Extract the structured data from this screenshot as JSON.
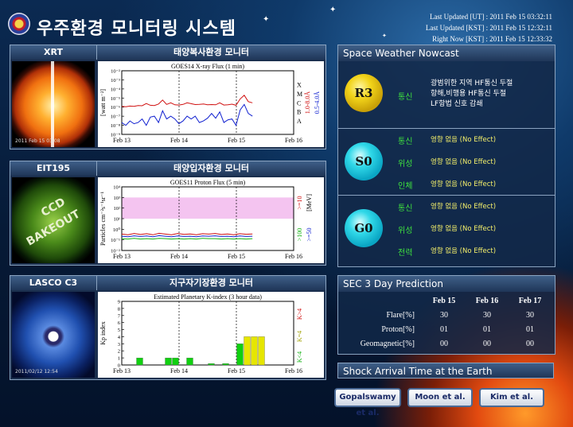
{
  "header": {
    "title": "우주환경 모니터링 시스템",
    "timestamps": [
      "Last Updated [UT] : 2011 Feb 15 03:32:11",
      "Last Updated [KST] : 2011 Feb 15 12:32:11",
      "Right Now [KST] : 2011 Feb 15 12:33:32"
    ]
  },
  "panels": [
    {
      "image_label": "XRT",
      "chart_label": "태양복사환경 모니터",
      "thumb_caption": "2011 Feb 15 03:08"
    },
    {
      "image_label": "EIT195",
      "chart_label": "태양입자환경 모니터",
      "thumb_text": [
        "CCD",
        "BAKEOUT"
      ]
    },
    {
      "image_label": "LASCO C3",
      "chart_label": "지구자기장환경 모니터",
      "thumb_caption": "2011/02/12 12:54"
    }
  ],
  "xray_chart": {
    "title": "GOES14 X-ray Flux (1 min)",
    "ylabel": "[watt m⁻²]",
    "y_ticks": [
      "10⁻²",
      "10⁻³",
      "10⁻⁴",
      "10⁻⁵",
      "10⁻⁶",
      "10⁻⁷",
      "10⁻⁸",
      "10⁻⁹"
    ],
    "x_ticks": [
      "Feb 13",
      "Feb 14",
      "Feb 15",
      "Feb 16"
    ],
    "classes": [
      "X",
      "M",
      "C",
      "B",
      "A"
    ],
    "right_label_red": "1.0-8.0Å",
    "right_label_blue": "0.5-4.0Å"
  },
  "proton_chart": {
    "title": "GOES11 Proton Flux (5 min)",
    "ylabel": "Particles cm⁻²s⁻¹sr⁻¹",
    "y_ticks": [
      "10⁴",
      "10³",
      "10²",
      "10¹",
      "10⁰",
      "10⁻¹",
      "10⁻²"
    ],
    "x_ticks": [
      "Feb 13",
      "Feb 14",
      "Feb 15",
      "Feb 16"
    ],
    "right_label_red": ">=10",
    "right_label_green": ">100",
    "right_label_blue": ">=50",
    "right_label_unit": "[MeV]"
  },
  "kp_chart": {
    "title": "Estimated Planetary K-index (3 hour data)",
    "ylabel": "Kp index",
    "y_ticks": [
      "9",
      "8",
      "7",
      "6",
      "5",
      "4",
      "3",
      "2",
      "1",
      "0"
    ],
    "x_ticks": [
      "Feb 13",
      "Feb 14",
      "Feb 15",
      "Feb 16"
    ],
    "legend_red": "K>4",
    "legend_yellow": "K=4",
    "legend_green": "K<4"
  },
  "chart_data": [
    {
      "type": "line",
      "title": "GOES14 X-ray Flux (1 min)",
      "ylabel": "[watt m⁻²]",
      "x_ticks": [
        "Feb 13",
        "Feb 14",
        "Feb 15",
        "Feb 16"
      ],
      "ylim": [
        1e-09,
        0.01
      ],
      "log_y": true,
      "series": [
        {
          "name": "1.0-8.0Å",
          "color": "#d01010",
          "values": [
            1.2e-06,
            1.1e-06,
            1.3e-06,
            1.2e-06,
            1.5e-06,
            1.4e-06,
            2.5e-06,
            1.6e-06,
            1.5e-06,
            2.2e-06,
            6e-06,
            2e-06,
            3e-06,
            1.8e-06,
            1.7e-06,
            2e-06,
            3e-06,
            2.4e-06,
            1.9e-06,
            2e-06,
            2.2e-06,
            1.8e-06,
            1.9e-06,
            1.8e-06,
            3e-06,
            1.7e-06,
            1.8e-06,
            2.1e-06,
            1.6e-06,
            8e-06,
            2e-05,
            4e-06,
            3e-06
          ]
        },
        {
          "name": "0.5-4.0Å",
          "color": "#1020d0",
          "values": [
            2e-08,
            1e-08,
            3e-08,
            1.5e-08,
            2e-08,
            5e-08,
            1e-08,
            8e-08,
            1e-07,
            2e-08,
            4e-07,
            5e-08,
            1e-07,
            5e-08,
            1.5e-08,
            3e-08,
            1e-07,
            5e-08,
            1e-07,
            2e-08,
            3e-08,
            6e-08,
            2e-07,
            6e-08,
            3e-07,
            2e-08,
            4e-08,
            5e-08,
            1e-08,
            5e-07,
            2e-06,
            2e-07,
            1e-07
          ]
        }
      ]
    },
    {
      "type": "line",
      "title": "GOES11 Proton Flux (5 min)",
      "ylabel": "Particles cm⁻²s⁻¹sr⁻¹",
      "x_ticks": [
        "Feb 13",
        "Feb 14",
        "Feb 15",
        "Feb 16"
      ],
      "ylim": [
        0.01,
        10000.0
      ],
      "log_y": true,
      "series": [
        {
          "name": ">=10",
          "color": "#d01010",
          "values": [
            0.35,
            0.3,
            0.4,
            0.32,
            0.38,
            0.3,
            0.42,
            0.35,
            0.3,
            0.4,
            0.33,
            0.36,
            0.3,
            0.38,
            0.35,
            0.4,
            0.32,
            0.36,
            0.3,
            0.38,
            0.34,
            0.36
          ]
        },
        {
          "name": ">=50",
          "color": "#1020d0",
          "values": [
            0.22,
            0.2,
            0.24,
            0.21,
            0.23,
            0.2,
            0.25,
            0.22,
            0.2,
            0.23,
            0.21,
            0.22,
            0.2,
            0.23,
            0.22,
            0.24,
            0.21,
            0.22,
            0.2,
            0.23,
            0.21,
            0.22
          ]
        },
        {
          "name": ">100",
          "color": "#10b010",
          "values": [
            0.13,
            0.12,
            0.14,
            0.12,
            0.13,
            0.12,
            0.14,
            0.13,
            0.12,
            0.13,
            0.12,
            0.13,
            0.12,
            0.14,
            0.13,
            0.13,
            0.12,
            0.13,
            0.12,
            0.13,
            0.12,
            0.13
          ]
        }
      ]
    },
    {
      "type": "bar",
      "title": "Estimated Planetary K-index (3 hour data)",
      "ylabel": "Kp index",
      "x_ticks": [
        "Feb 13",
        "Feb 14",
        "Feb 15",
        "Feb 16"
      ],
      "ylim": [
        0,
        9
      ],
      "bars": [
        {
          "index": 2,
          "value": 1,
          "color": "#10d010"
        },
        {
          "index": 6,
          "value": 1,
          "color": "#10d010"
        },
        {
          "index": 7,
          "value": 1,
          "color": "#10d010"
        },
        {
          "index": 9,
          "value": 1,
          "color": "#10d010"
        },
        {
          "index": 12,
          "value": 0.2,
          "color": "#10d010"
        },
        {
          "index": 14,
          "value": 0.2,
          "color": "#10d010"
        },
        {
          "index": 16,
          "value": 3,
          "color": "#10d010"
        },
        {
          "index": 17,
          "value": 4,
          "color": "#e6e600"
        },
        {
          "index": 18,
          "value": 4,
          "color": "#e6e600"
        },
        {
          "index": 19,
          "value": 4,
          "color": "#e6e600"
        }
      ],
      "bins": 24
    }
  ],
  "nowcast": {
    "title": "Space Weather Nowcast",
    "groups": [
      {
        "badge": "R3",
        "rows": [
          {
            "cat": "통신",
            "value": "광범위한 지역 HF통신 두절\n항해,비행용 HF통신 두절\nLF항법 신호 감쇄"
          }
        ]
      },
      {
        "badge": "S0",
        "rows": [
          {
            "cat": "통신",
            "value": "영향 없음 (No Effect)"
          },
          {
            "cat": "위성",
            "value": "영향 없음 (No Effect)"
          },
          {
            "cat": "인체",
            "value": "영향 없음 (No Effect)"
          }
        ]
      },
      {
        "badge": "G0",
        "rows": [
          {
            "cat": "통신",
            "value": "영향 없음 (No Effect)"
          },
          {
            "cat": "위성",
            "value": "영향 없음 (No Effect)"
          },
          {
            "cat": "전력",
            "value": "영향 없음 (No Effect)"
          }
        ]
      }
    ]
  },
  "prediction": {
    "title": "SEC 3 Day Prediction",
    "columns": [
      "Feb 15",
      "Feb 16",
      "Feb 17"
    ],
    "rows": [
      {
        "label": "Flare[%]",
        "values": [
          "30",
          "30",
          "30"
        ]
      },
      {
        "label": "Proton[%]",
        "values": [
          "01",
          "01",
          "01"
        ]
      },
      {
        "label": "Geomagnetic[%]",
        "values": [
          "00",
          "00",
          "00"
        ]
      }
    ]
  },
  "shock": {
    "title": "Shock Arrival Time at the Earth",
    "buttons": [
      "Gopalswamy et al.",
      "Moon et al.",
      "Kim et al."
    ]
  }
}
